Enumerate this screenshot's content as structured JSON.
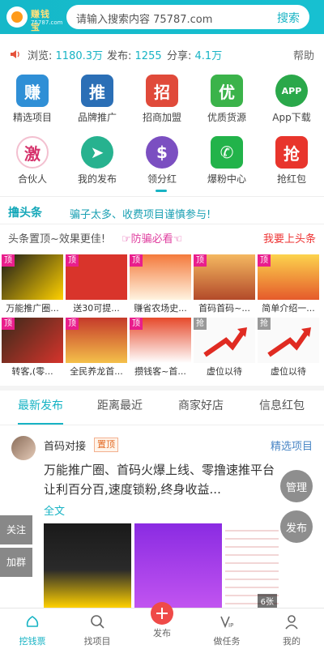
{
  "header": {
    "logo_text": "赚钱宝",
    "logo_sub": "75787.com",
    "search_placeholder": "请输入搜索内容  75787.com",
    "search_button": "搜索"
  },
  "stats": {
    "views_label": "浏览:",
    "views_value": "1180.3万",
    "posts_label": "发布:",
    "posts_value": "1255",
    "shares_label": "分享:",
    "shares_value": "4.1万",
    "help": "帮助"
  },
  "grid": [
    {
      "label": "精选项目",
      "glyph": "赚",
      "color": "#2f8fd6"
    },
    {
      "label": "品牌推广",
      "glyph": "推",
      "color": "#2b6fb6"
    },
    {
      "label": "招商加盟",
      "glyph": "招",
      "color": "#e04a3a"
    },
    {
      "label": "优质货源",
      "glyph": "优",
      "color": "#3bb34a"
    },
    {
      "label": "App下载",
      "glyph": "APP",
      "color": "#2aa84a"
    },
    {
      "label": "合伙人",
      "glyph": "激",
      "color": "#d6336c"
    },
    {
      "label": "我的发布",
      "glyph": "➤",
      "color": "#27b28f"
    },
    {
      "label": "领分红",
      "glyph": "$",
      "color": "#7b4fc1"
    },
    {
      "label": "爆粉中心",
      "glyph": "✆",
      "color": "#22b34a"
    },
    {
      "label": "抢红包",
      "glyph": "抢",
      "color": "#e8352c"
    }
  ],
  "headline": {
    "logo": "撸头条",
    "text": "骗子太多、收费项目谨慎参与!"
  },
  "promo": {
    "left": "头条置顶~效果更佳!",
    "middle": "☞防骗必看☜",
    "right": "我要上头条"
  },
  "tiles": [
    {
      "tag": "顶",
      "caption": "万能推广圈...",
      "bg": "#222"
    },
    {
      "tag": "顶",
      "caption": "送30可提...",
      "bg": "#d9342b"
    },
    {
      "tag": "顶",
      "caption": "赚省农场史...",
      "bg": "#f47a3c"
    },
    {
      "tag": "顶",
      "caption": "首码首码~...",
      "bg": "#e8833a"
    },
    {
      "tag": "顶",
      "caption": "简单介绍一...",
      "bg": "#f2a62c"
    },
    {
      "tag": "顶",
      "caption": "转客,(零...",
      "bg": "#3a2a1a"
    },
    {
      "tag": "顶",
      "caption": "全民养龙首...",
      "bg": "#c53a2a"
    },
    {
      "tag": "顶",
      "caption": "攒钱客~首...",
      "bg": "#e64a2b"
    },
    {
      "tag": "抢",
      "caption": "虚位以待",
      "bg": "#ffffff"
    },
    {
      "tag": "抢",
      "caption": "虚位以待",
      "bg": "#ffffff"
    }
  ],
  "tabs": [
    "最新发布",
    "距离最近",
    "商家好店",
    "信息红包"
  ],
  "post": {
    "author": "首码对接",
    "badge": "置顶",
    "category": "精选项目",
    "text": "万能推广圈、首码火爆上线、零撸速推平台让利百分百,速度锁粉,终身收益...",
    "full": "全文",
    "image_count": "6张"
  },
  "side": {
    "follow": "关注",
    "group": "加群",
    "manage": "管理",
    "publish": "发布"
  },
  "nav": [
    {
      "label": "挖钱票",
      "icon": "home-icon"
    },
    {
      "label": "找项目",
      "icon": "search-icon"
    },
    {
      "label": "发布",
      "icon": "plus-icon"
    },
    {
      "label": "做任务",
      "icon": "vip-icon"
    },
    {
      "label": "我的",
      "icon": "user-icon"
    }
  ]
}
